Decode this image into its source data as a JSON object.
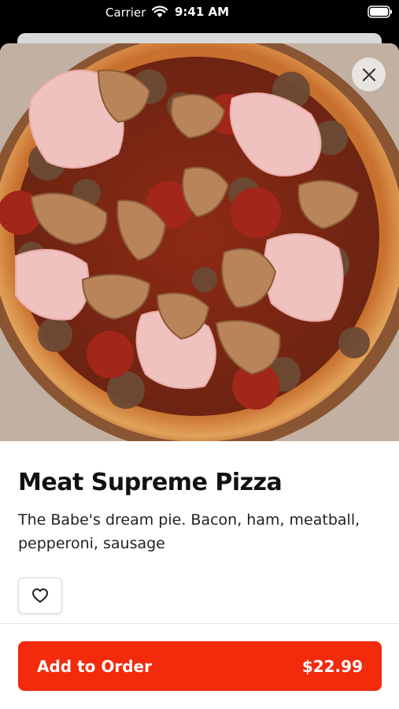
{
  "status_bar": {
    "carrier": "Carrier",
    "time": "9:41 AM"
  },
  "product": {
    "name": "Meat Supreme Pizza",
    "description": "The Babe's dream pie. Bacon, ham, meatball, pepperoni, sausage",
    "price": "$22.99",
    "image": "pizza-photo"
  },
  "actions": {
    "add_label": "Add to Order",
    "close_icon": "close-icon",
    "favorite_icon": "heart-icon"
  },
  "colors": {
    "accent": "#f42a0c",
    "background": "#ffffff"
  }
}
